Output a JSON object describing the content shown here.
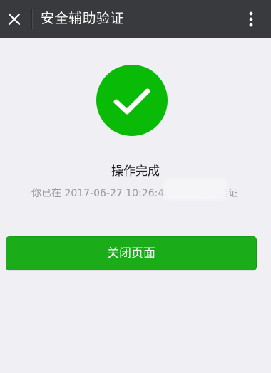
{
  "topbar": {
    "title": "安全辅助验证",
    "close_icon": "close-icon",
    "more_icon": "more-vertical-icon"
  },
  "result": {
    "icon": "success-check-icon",
    "accent_color": "#09bb07",
    "title": "操作完成",
    "description": "你已在 2017-06-27 10:26:48 为 w          辅助验证"
  },
  "actions": {
    "close_page_label": "关闭页面",
    "button_color": "#1aad19"
  }
}
